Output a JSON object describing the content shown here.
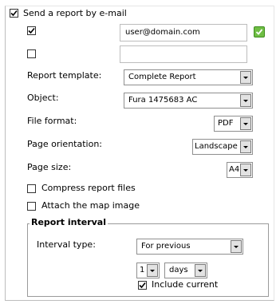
{
  "send_report": {
    "label": "Send a report by e-mail",
    "checked": true
  },
  "emails": [
    {
      "checked": true,
      "value": "user@domain.com",
      "status_icon": "green-check-icon"
    },
    {
      "checked": false,
      "value": ""
    }
  ],
  "fields": {
    "report_template": {
      "label": "Report template:",
      "value": "Complete Report"
    },
    "object": {
      "label": "Object:",
      "value": "Fura 1475683 AC"
    },
    "file_format": {
      "label": "File format:",
      "value": "PDF"
    },
    "page_orientation": {
      "label": "Page orientation:",
      "value": "Landscape"
    },
    "page_size": {
      "label": "Page size:",
      "value": "A4"
    }
  },
  "options": {
    "compress": {
      "label": "Compress report files",
      "checked": false
    },
    "attach_map": {
      "label": "Attach the map image",
      "checked": false
    }
  },
  "interval": {
    "title": "Report interval",
    "type_label": "Interval type:",
    "type_value": "For previous",
    "count_value": "1",
    "unit_value": "days",
    "include_current": {
      "label": "Include current",
      "checked": true
    }
  }
}
